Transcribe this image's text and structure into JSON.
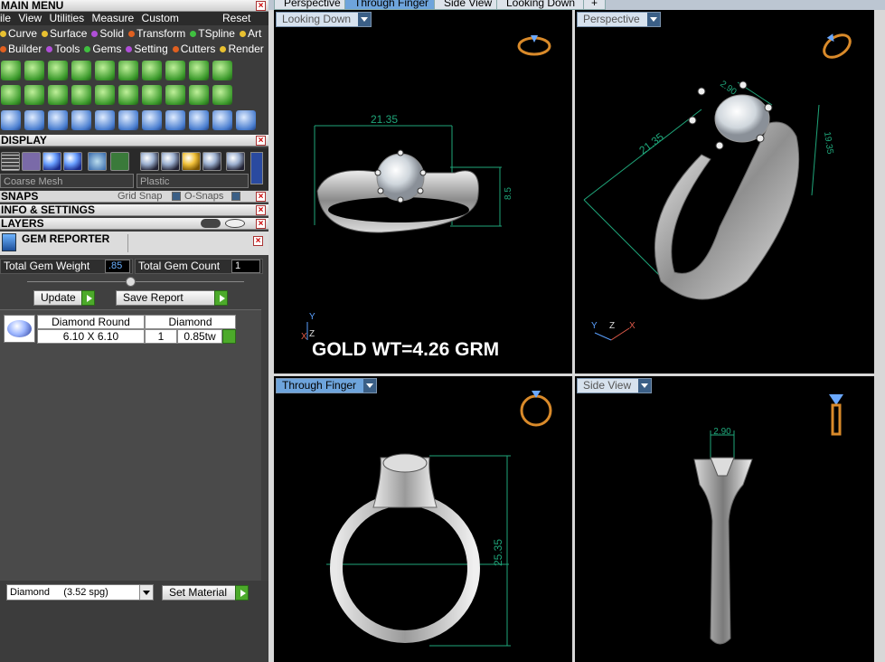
{
  "panel": {
    "main_menu_title": "MAIN MENU",
    "menu_items": [
      "ile",
      "View",
      "Utilities",
      "Measure",
      "Custom"
    ],
    "reset": "Reset",
    "categories_row1": [
      {
        "label": "Curve",
        "color": "#e8c030"
      },
      {
        "label": "Surface",
        "color": "#e8c030"
      },
      {
        "label": "Solid",
        "color": "#b04fd8"
      },
      {
        "label": "Transform",
        "color": "#e06020"
      },
      {
        "label": "TSpline",
        "color": "#40c040"
      },
      {
        "label": "Art",
        "color": "#e8c030"
      }
    ],
    "categories_row2": [
      {
        "label": "Builder",
        "color": "#e06020"
      },
      {
        "label": "Tools",
        "color": "#b04fd8"
      },
      {
        "label": "Gems",
        "color": "#40c040"
      },
      {
        "label": "Setting",
        "color": "#b04fd8"
      },
      {
        "label": "Cutters",
        "color": "#e06020"
      },
      {
        "label": "Render",
        "color": "#e8c030"
      }
    ],
    "display_title": "DISPLAY",
    "display_mesh": "Coarse Mesh",
    "display_material": "Plastic",
    "snaps_title": "SNAPS",
    "grid_snap": "Grid Snap",
    "o_snaps": "O-Snaps",
    "info_title": "INFO & SETTINGS",
    "layers_title": "LAYERS",
    "gem_reporter_title": "GEM REPORTER",
    "total_gem_weight_label": "Total Gem Weight",
    "total_gem_weight_value": ".85",
    "total_gem_count_label": "Total Gem Count",
    "total_gem_count_value": "1",
    "update_button": "Update",
    "save_report_button": "Save Report",
    "gem_table": {
      "headers": [
        "Diamond Round",
        "Diamond"
      ],
      "size": "6.10 X 6.10",
      "count": "1",
      "weight": "0.85tw"
    },
    "material_select": "Diamond     (3.52 spg)",
    "set_material_button": "Set Material"
  },
  "tabs": [
    "Perspective",
    "Through Finger",
    "Side View",
    "Looking Down",
    "+"
  ],
  "active_tab": "Through Finger",
  "viewports": {
    "top_left": {
      "label": "Looking Down",
      "dim_width": "21.35",
      "dim_height": "8.5",
      "annotation": "GOLD WT=4.26 GRM",
      "axes": [
        "Y",
        "Z",
        "X"
      ]
    },
    "top_right": {
      "label": "Perspective",
      "dim_width": "21.35",
      "dim_depth": "19.35",
      "dim_small": "2.90",
      "axes": [
        "Y",
        "Z",
        "X"
      ]
    },
    "bottom_left": {
      "label": "Through Finger",
      "dim_height": "25.35"
    },
    "bottom_right": {
      "label": "Side View",
      "dim_top": "2.90"
    }
  },
  "colors": {
    "dimension_line": "#1fa67a",
    "viewport_bg": "#000000",
    "active_tab": "#6ea4dc",
    "panel_bg": "#3c3c3c"
  }
}
